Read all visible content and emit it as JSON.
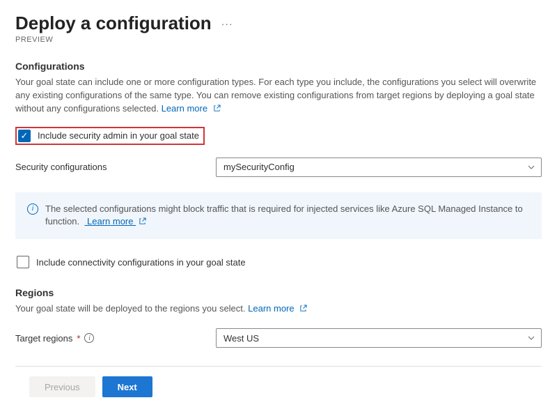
{
  "header": {
    "title": "Deploy a configuration",
    "preview_label": "PREVIEW"
  },
  "configurations": {
    "section_title": "Configurations",
    "help_text": "Your goal state can include one or more configuration types. For each type you include, the configurations you select will overwrite any existing configurations of the same type. You can remove existing configurations from target regions by deploying a goal state without any configurations selected.",
    "learn_more": "Learn more",
    "include_security_label": "Include security admin in your goal state",
    "security_configs_label": "Security configurations",
    "security_configs_value": "mySecurityConfig",
    "info_box_text": "The selected configurations might block traffic that is required for injected services like Azure SQL Managed Instance to function.",
    "info_box_learn_more": "Learn more",
    "include_connectivity_label": "Include connectivity configurations in your goal state"
  },
  "regions": {
    "section_title": "Regions",
    "help_text": "Your goal state will be deployed to the regions you select.",
    "learn_more": "Learn more",
    "target_regions_label": "Target regions",
    "target_regions_value": "West US"
  },
  "footer": {
    "previous_label": "Previous",
    "next_label": "Next"
  }
}
